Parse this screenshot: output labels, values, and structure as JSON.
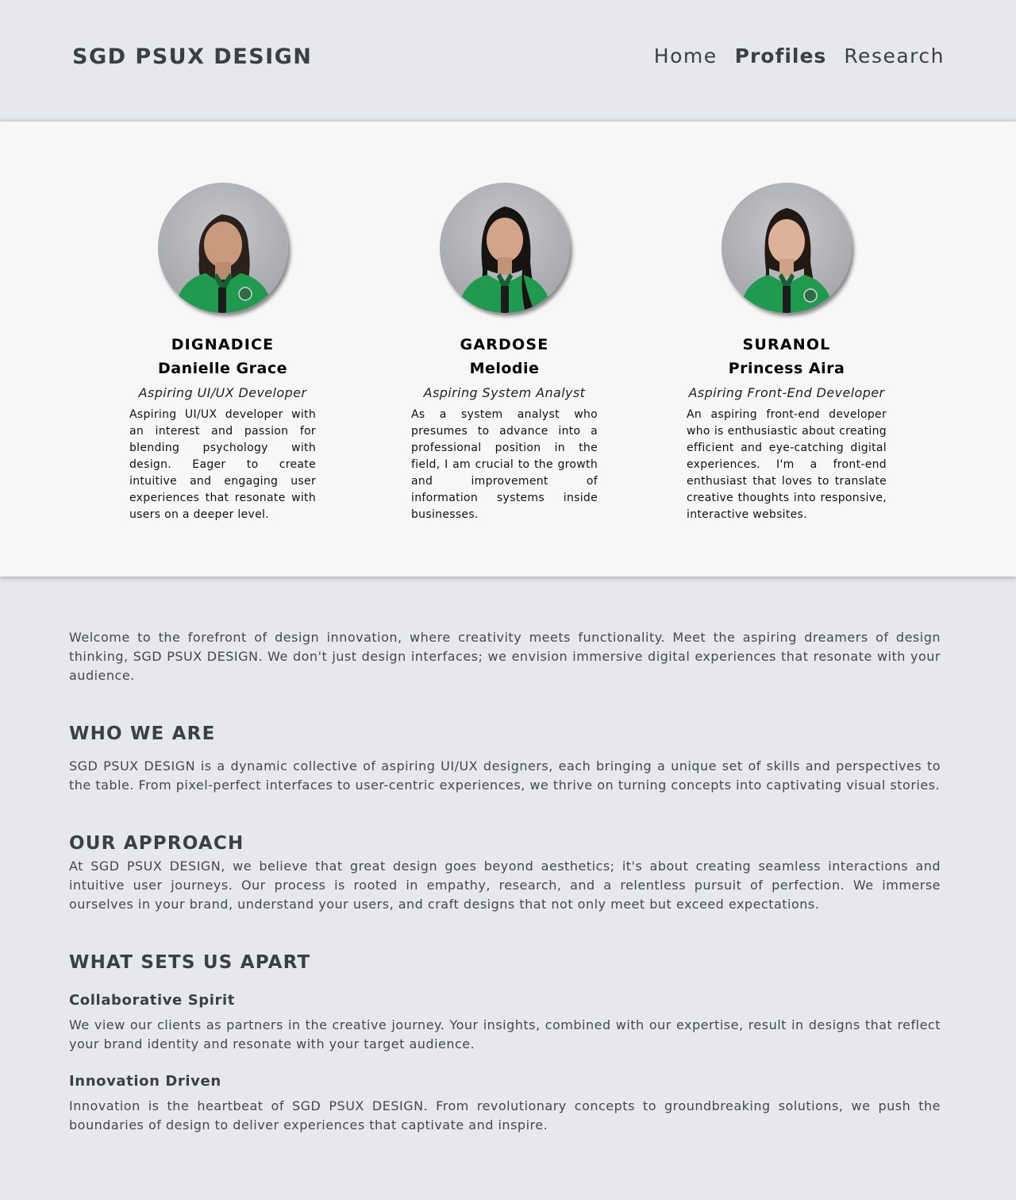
{
  "header": {
    "brand": "SGD PSUX DESIGN",
    "nav": [
      {
        "label": "Home",
        "active": false
      },
      {
        "label": "Profiles",
        "active": true
      },
      {
        "label": "Research",
        "active": false
      }
    ]
  },
  "profiles": [
    {
      "last_name": "DIGNADICE",
      "first_name": "Danielle Grace",
      "role": "Aspiring UI/UX Developer",
      "bio": "Aspiring UI/UX developer with an interest and passion for blending psychology with design. Eager to create intuitive and engaging user experiences that resonate with users on a deeper level.",
      "photo": "profile-photo"
    },
    {
      "last_name": "GARDOSE",
      "first_name": "Melodie",
      "role": "Aspiring System Analyst",
      "bio": " As a system analyst who presumes to advance into a professional position in the field, I am crucial to the growth and improvement of information systems inside businesses.",
      "photo": "profile-photo"
    },
    {
      "last_name": "SURANOL",
      "first_name": "Princess Aira",
      "role": "Aspiring Front-End Developer",
      "bio": "An aspiring front-end developer who is enthusiastic about creating efficient and eye-catching digital experiences. I'm a front-end enthusiast that loves to translate creative thoughts into responsive, interactive websites.",
      "photo": "profile-photo"
    }
  ],
  "content": {
    "intro": "Welcome to the forefront of design innovation, where creativity meets functionality. Meet the aspiring dreamers of design thinking, SGD PSUX DESIGN. We don't just design interfaces; we envision immersive digital experiences that resonate with your audience.",
    "who_heading": "WHO WE ARE",
    "who_text": "SGD PSUX DESIGN is a dynamic collective of aspiring UI/UX designers, each bringing a unique set of skills and perspectives to the table. From pixel-perfect interfaces to user-centric experiences, we thrive on turning concepts into captivating visual stories.",
    "approach_heading": "OUR APPROACH",
    "approach_text": "At SGD PSUX DESIGN, we believe that great design goes beyond aesthetics; it's about creating seamless interactions and intuitive user journeys. Our process is rooted in empathy, research, and a relentless pursuit of perfection. We immerse ourselves in your brand, understand your users, and craft designs that not only meet but exceed expectations.",
    "apart_heading": "WHAT SETS US APART",
    "collab_heading": "Collaborative Spirit",
    "collab_text": "We view our clients as partners in the creative journey. Your insights, combined with our expertise, result in designs that reflect your brand identity and resonate with your target audience.",
    "innov_heading": "Innovation Driven",
    "innov_text": "Innovation is the heartbeat of SGD PSUX DESIGN. From revolutionary concepts to groundbreaking solutions, we push the boundaries of design to deliver experiences that captivate and inspire."
  },
  "colors": {
    "page_bg": "#e6e7ef",
    "band_bg": "#f7f7f7",
    "text_dark": "#3b4047",
    "shirt_green": "#1f9a4e"
  }
}
